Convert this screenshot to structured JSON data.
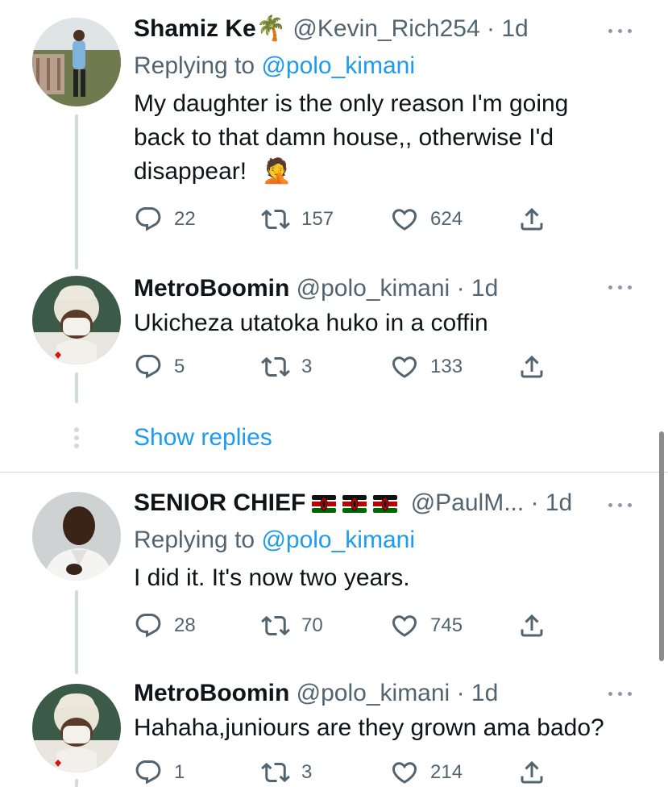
{
  "tweets": [
    {
      "name": "Shamiz Ke",
      "name_emoji": "🌴",
      "handle": "@Kevin_Rich254",
      "time": "· 1d",
      "replying_prefix": "Replying to",
      "replying_handle": "@polo_kimani",
      "text": "My daughter is the only reason I'm going back to that damn house,, otherwise I'd disappear!",
      "text_emoji": "🤦",
      "replies": "22",
      "retweets": "157",
      "likes": "624"
    },
    {
      "name": "MetroBoomin",
      "handle": "@polo_kimani",
      "time": "· 1d",
      "text": "Ukicheza utatoka huko in a coffin",
      "replies": "5",
      "retweets": "3",
      "likes": "133"
    },
    {
      "name": "SENIOR CHIEF",
      "handle": "@PaulM...",
      "time": "· 1d",
      "replying_prefix": "Replying to",
      "replying_handle": "@polo_kimani",
      "text": "I did it. It's now two years.",
      "replies": "28",
      "retweets": "70",
      "likes": "745"
    },
    {
      "name": "MetroBoomin",
      "handle": "@polo_kimani",
      "time": "· 1d",
      "text": "Hahaha,juniours are they grown ama bado?",
      "replies": "1",
      "retweets": "3",
      "likes": "214"
    }
  ],
  "show_replies_label": "Show replies",
  "icons": {
    "reply": "reply-icon",
    "retweet": "retweet-icon",
    "like": "heart-icon",
    "share": "share-icon",
    "more": "more-icon",
    "flag": "kenya-flag-icon"
  },
  "colors": {
    "link": "#1d9bf0",
    "muted": "#536471",
    "line": "#cfd9de"
  }
}
